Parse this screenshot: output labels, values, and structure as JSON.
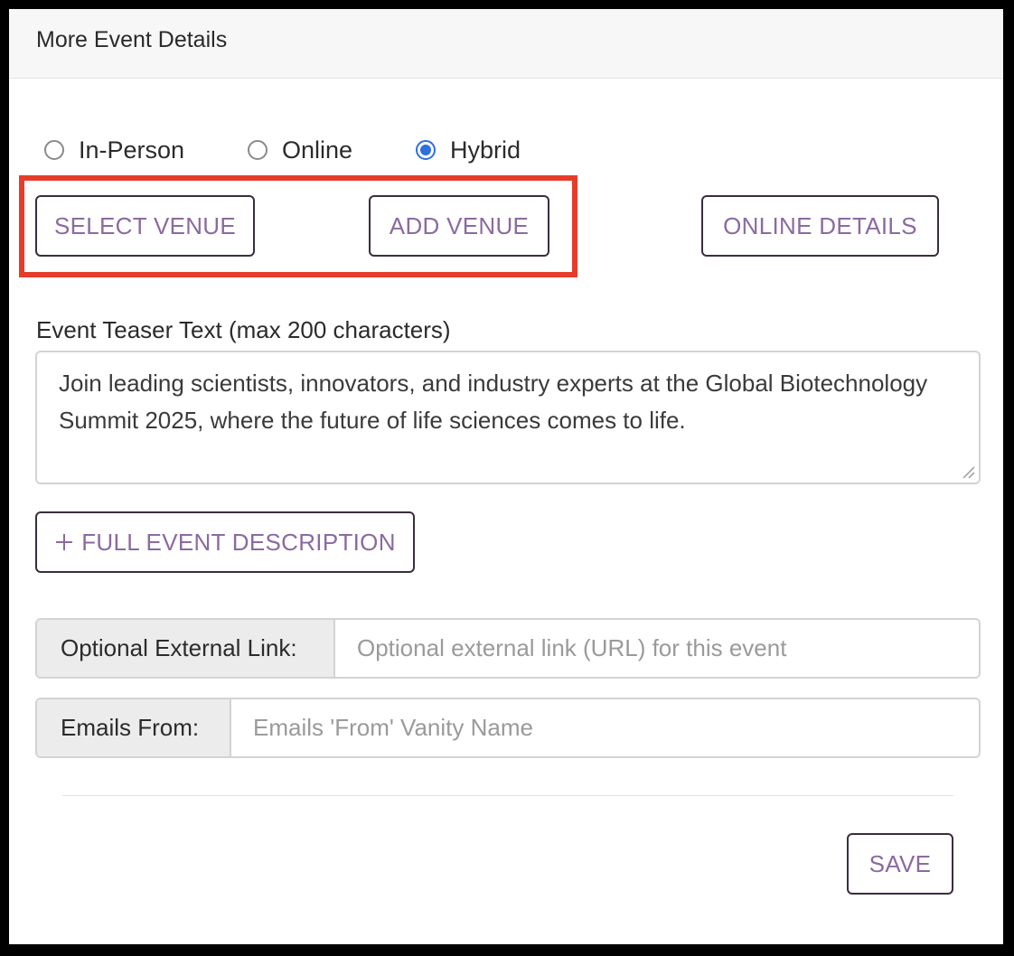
{
  "panel": {
    "title": "More Event Details"
  },
  "event_type": {
    "options": [
      {
        "label": "In-Person",
        "selected": false
      },
      {
        "label": "Online",
        "selected": false
      },
      {
        "label": "Hybrid",
        "selected": true
      }
    ]
  },
  "venue_buttons": {
    "select_venue": "SELECT VENUE",
    "add_venue": "ADD VENUE",
    "online_details": "ONLINE DETAILS"
  },
  "teaser": {
    "label": "Event Teaser Text (max 200 characters)",
    "value": "Join leading scientists, innovators, and industry experts at the Global Biotechnology Summit 2025, where the future of life sciences comes to life."
  },
  "full_description_button": {
    "icon": "plus-icon",
    "label": "FULL EVENT DESCRIPTION"
  },
  "external_link": {
    "label": "Optional External Link:",
    "placeholder": "Optional external link (URL) for this event",
    "value": ""
  },
  "emails_from": {
    "label": "Emails From:",
    "placeholder": "Emails 'From' Vanity Name",
    "value": ""
  },
  "save_button": "SAVE",
  "colors": {
    "accent_text": "#8b6aa0",
    "button_border": "#3a2d3e",
    "radio_selected": "#2f6fde",
    "highlight": "#e63c2a"
  }
}
